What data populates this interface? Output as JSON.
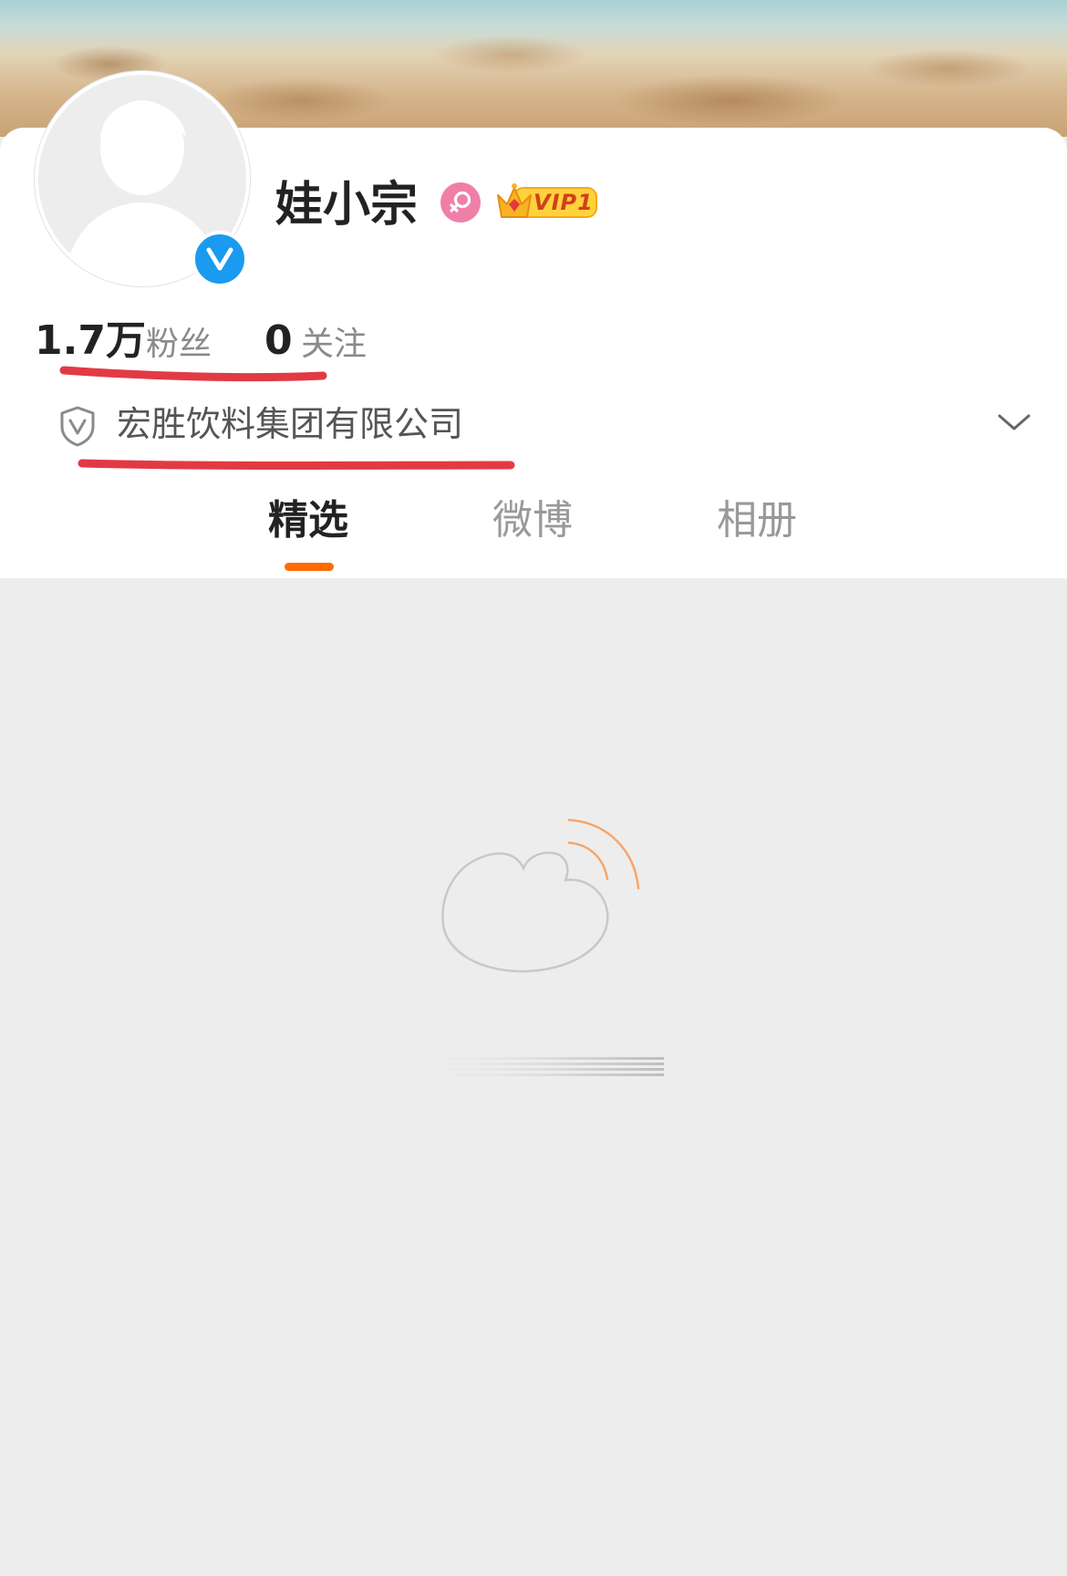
{
  "profile": {
    "name": "娃小宗",
    "verified_icon": "verified-v-icon",
    "gender_icon": "female-icon",
    "vip_badge": "VIP1",
    "gender_color": "#f07fa8",
    "verified_color": "#1a9bf0"
  },
  "stats": {
    "followers_count": "1.7万",
    "followers_label": "粉丝",
    "following_count": "0",
    "following_label": "关注"
  },
  "verification": {
    "icon": "shield-v-icon",
    "company": "宏胜饮料集团有限公司",
    "expand_icon": "chevron-down-icon"
  },
  "tabs": [
    {
      "label": "精选",
      "active": true
    },
    {
      "label": "微博",
      "active": false
    },
    {
      "label": "相册",
      "active": false
    }
  ],
  "content": {
    "state": "loading",
    "loader_icon": "weibo-logo-icon"
  },
  "colors": {
    "accent": "#ff6b00",
    "annotation_red": "#e23a44",
    "page_bg": "#ededed"
  }
}
